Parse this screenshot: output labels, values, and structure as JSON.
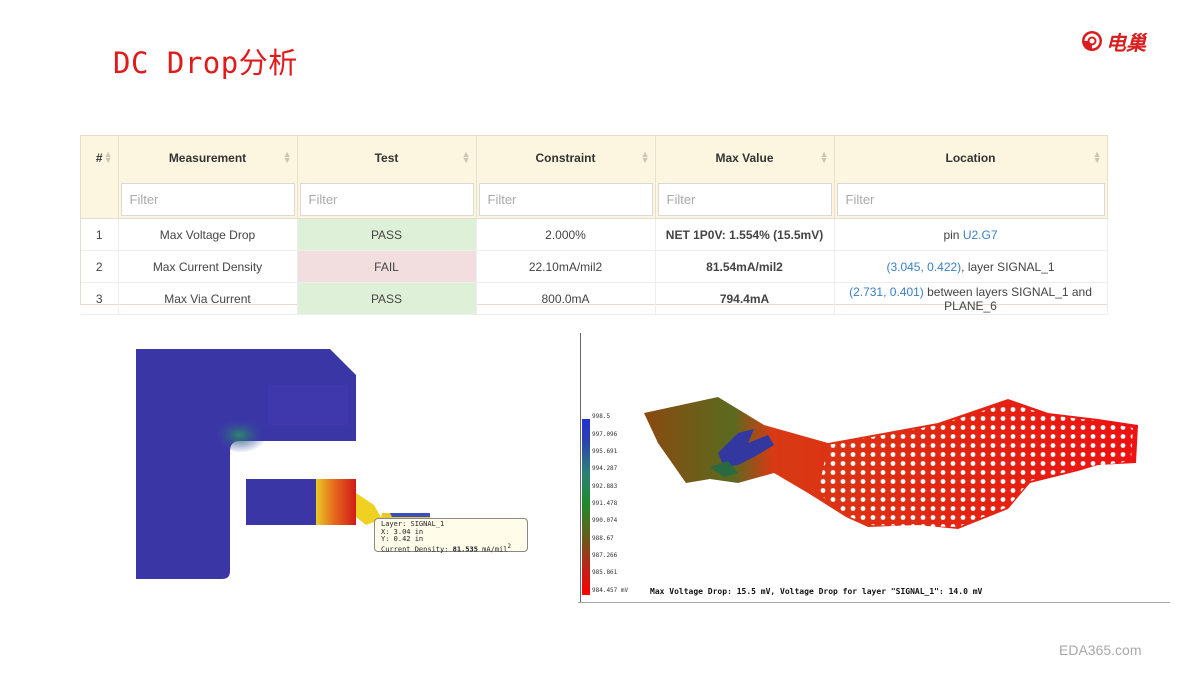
{
  "slide_title": "DC Drop分析",
  "logo": {
    "text": "电巢",
    "icon": "logo-swirl-icon",
    "color": "#d81e1e"
  },
  "table": {
    "headers": [
      "#",
      "Measurement",
      "Test",
      "Constraint",
      "Max Value",
      "Location"
    ],
    "filter_placeholder": "Filter",
    "rows": [
      {
        "num": "1",
        "measurement": "Max Voltage Drop",
        "test": "PASS",
        "constraint": "2.000%",
        "max_value": "NET 1P0V: 1.554% (15.5mV)",
        "location_prefix": "pin ",
        "location_link": "U2.G7",
        "location_suffix": ""
      },
      {
        "num": "2",
        "measurement": "Max Current Density",
        "test": "FAIL",
        "constraint": "22.10mA/mil2",
        "max_value": "81.54mA/mil2",
        "location_prefix": "",
        "location_link": "(3.045, 0.422)",
        "location_suffix": ", layer SIGNAL_1"
      },
      {
        "num": "3",
        "measurement": "Max Via Current",
        "test": "PASS",
        "constraint": "800.0mA",
        "max_value": "794.4mA",
        "location_prefix": "",
        "location_link": "(2.731, 0.401)",
        "location_suffix": " between layers SIGNAL_1 and PLANE_6"
      }
    ],
    "status_colors": {
      "pass": "#dff0d8",
      "fail": "#f2dede"
    }
  },
  "tooltip": {
    "layer": "Layer: SIGNAL_1",
    "x": "X: 3.04 in",
    "y": "Y: 0.42 in",
    "density_label": "Current Density: ",
    "density_value": "81.535",
    "density_unit": "mA/mil",
    "density_sup": "2"
  },
  "colorbar": {
    "labels": [
      "998.5",
      "997.096",
      "995.691",
      "994.287",
      "992.883",
      "991.478",
      "990.074",
      "988.67",
      "987.266",
      "985.861",
      "984.457 mV"
    ]
  },
  "voltage_caption": "Max Voltage Drop: 15.5 mV, Voltage Drop for layer \"SIGNAL_1\": 14.0 mV",
  "watermark": "EDA365.com"
}
